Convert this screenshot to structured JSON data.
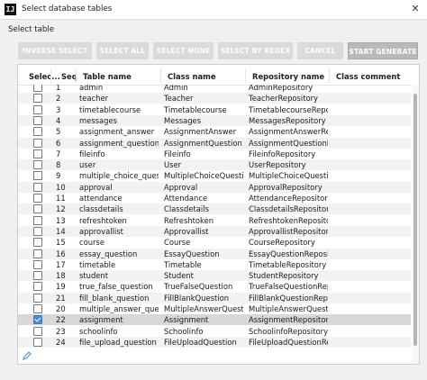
{
  "window": {
    "title": "Select database tables",
    "icon_text": "IJ"
  },
  "subtitle": "Select table",
  "toolbar": {
    "buttons": [
      "INVERSE SELECT",
      "SELECT ALL",
      "SELECT NONE",
      "SELECT BY REGEX",
      "CANCEL",
      "START GENERATE"
    ]
  },
  "table": {
    "headers": [
      "Selec...",
      "Seq",
      "Table name",
      "Class name",
      "Repository name",
      "Class comment"
    ],
    "rows": [
      {
        "checked": false,
        "seq": "1",
        "table": "admin",
        "class": "Admin",
        "repo": "AdminRepository"
      },
      {
        "checked": false,
        "seq": "2",
        "table": "teacher",
        "class": "Teacher",
        "repo": "TeacherRepository"
      },
      {
        "checked": false,
        "seq": "3",
        "table": "timetablecourse",
        "class": "Timetablecourse",
        "repo": "TimetablecourseReposito..."
      },
      {
        "checked": false,
        "seq": "4",
        "table": "messages",
        "class": "Messages",
        "repo": "MessagesRepository"
      },
      {
        "checked": false,
        "seq": "5",
        "table": "assignment_answer",
        "class": "AssignmentAnswer",
        "repo": "AssignmentAnswerRepos..."
      },
      {
        "checked": false,
        "seq": "6",
        "table": "assignment_question",
        "class": "AssignmentQuestion",
        "repo": "AssignmentQuestionRepo..."
      },
      {
        "checked": false,
        "seq": "7",
        "table": "fileinfo",
        "class": "Fileinfo",
        "repo": "FileinfoRepository"
      },
      {
        "checked": false,
        "seq": "8",
        "table": "user",
        "class": "User",
        "repo": "UserRepository"
      },
      {
        "checked": false,
        "seq": "9",
        "table": "multiple_choice_question",
        "class": "MultipleChoiceQuestion",
        "repo": "MultipleChoiceQuestion..."
      },
      {
        "checked": false,
        "seq": "10",
        "table": "approval",
        "class": "Approval",
        "repo": "ApprovalRepository"
      },
      {
        "checked": false,
        "seq": "11",
        "table": "attendance",
        "class": "Attendance",
        "repo": "AttendanceRepository"
      },
      {
        "checked": false,
        "seq": "12",
        "table": "classdetails",
        "class": "Classdetails",
        "repo": "ClassdetailsRepository"
      },
      {
        "checked": false,
        "seq": "13",
        "table": "refreshtoken",
        "class": "Refreshtoken",
        "repo": "RefreshtokenRepository"
      },
      {
        "checked": false,
        "seq": "14",
        "table": "approvallist",
        "class": "Approvallist",
        "repo": "ApprovallistRepository"
      },
      {
        "checked": false,
        "seq": "15",
        "table": "course",
        "class": "Course",
        "repo": "CourseRepository"
      },
      {
        "checked": false,
        "seq": "16",
        "table": "essay_question",
        "class": "EssayQuestion",
        "repo": "EssayQuestionRepository"
      },
      {
        "checked": false,
        "seq": "17",
        "table": "timetable",
        "class": "Timetable",
        "repo": "TimetableRepository"
      },
      {
        "checked": false,
        "seq": "18",
        "table": "student",
        "class": "Student",
        "repo": "StudentRepository"
      },
      {
        "checked": false,
        "seq": "19",
        "table": "true_false_question",
        "class": "TrueFalseQuestion",
        "repo": "TrueFalseQuestionRepo..."
      },
      {
        "checked": false,
        "seq": "21",
        "table": "fill_blank_question",
        "class": "FillBlankQuestion",
        "repo": "FillBlankQuestionReposi..."
      },
      {
        "checked": false,
        "seq": "20",
        "table": "multiple_answer_question",
        "class": "MultipleAnswerQuestion",
        "repo": "MultipleAnswerQuestion..."
      },
      {
        "checked": true,
        "seq": "22",
        "table": "assignment",
        "class": "Assignment",
        "repo": "AssignmentRepository"
      },
      {
        "checked": false,
        "seq": "23",
        "table": "schoolinfo",
        "class": "Schoolinfo",
        "repo": "SchoolinfoRepository"
      },
      {
        "checked": false,
        "seq": "24",
        "table": "file_upload_question",
        "class": "FileUploadQuestion",
        "repo": "FileUploadQuestionRepo..."
      }
    ]
  },
  "icons": {
    "close": "close-icon",
    "edit": "pencil-icon"
  },
  "colors": {
    "accent": "#4a8ed8",
    "selected_row": "#d8d8d8",
    "button_disabled": "#dadada"
  }
}
